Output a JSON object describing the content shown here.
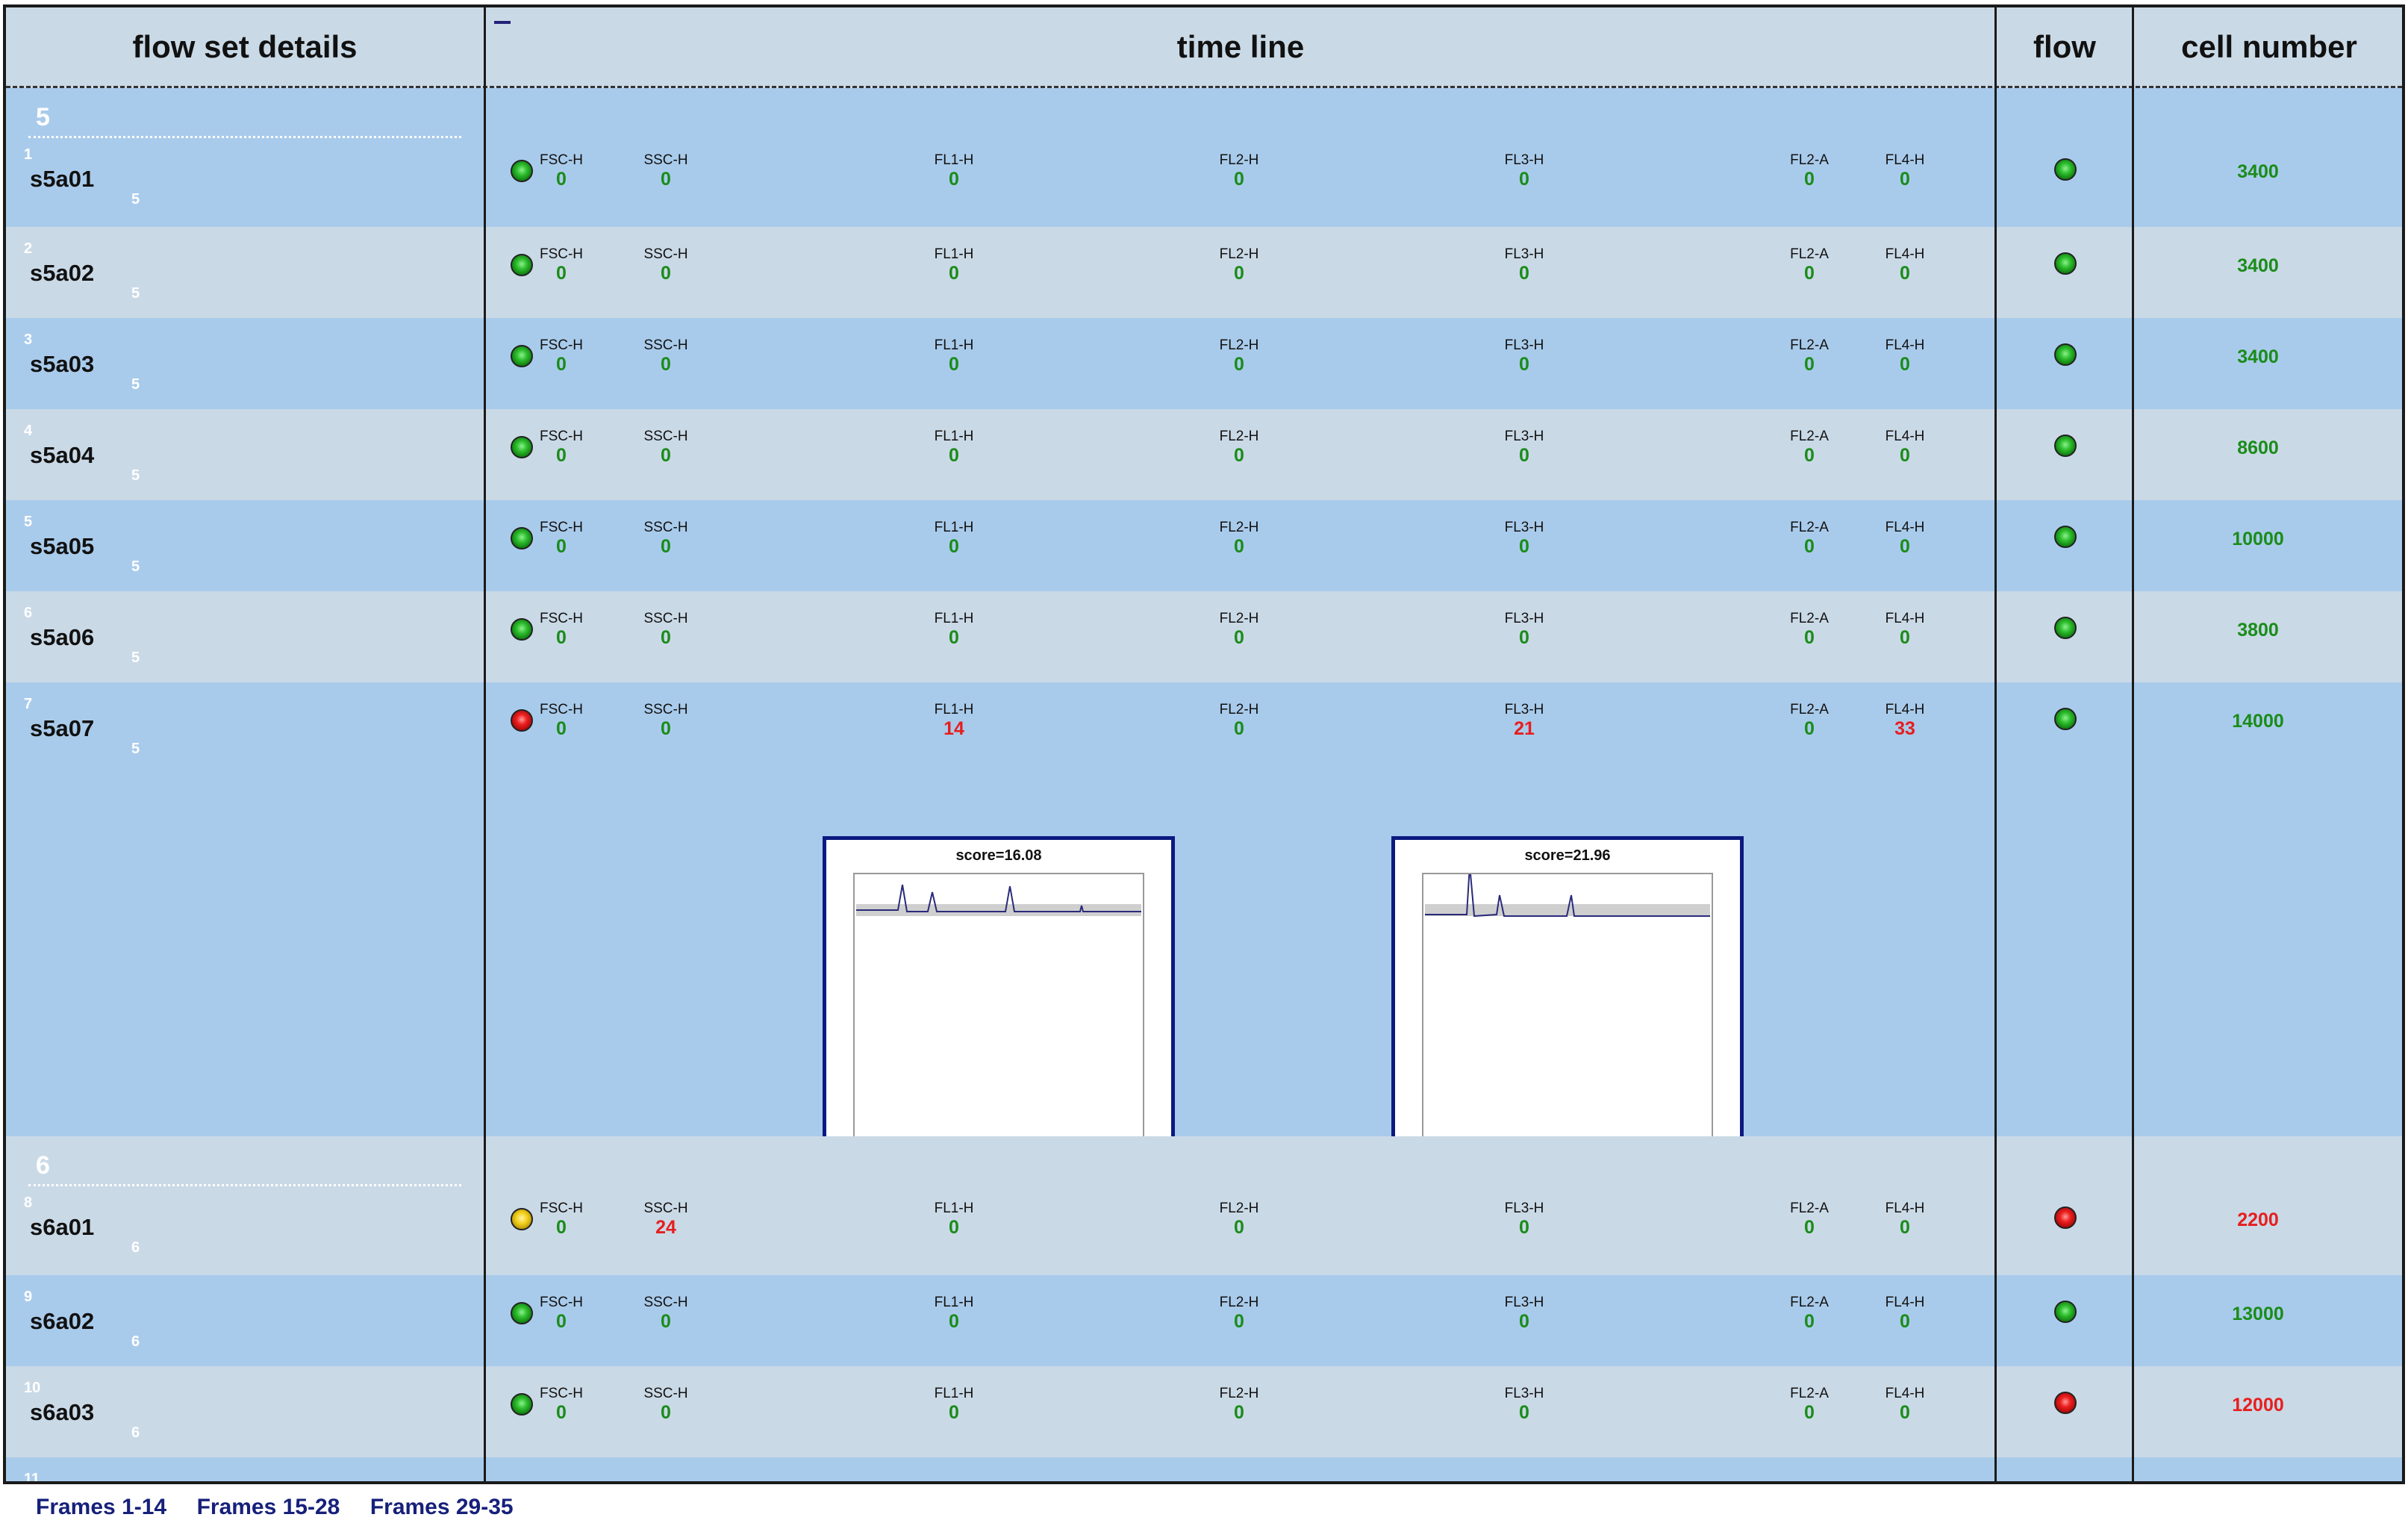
{
  "headers": {
    "details": "flow set details",
    "timeline": "time line",
    "flow": "flow",
    "cells": "cell number"
  },
  "channels": [
    "FSC-H",
    "SSC-H",
    "FL1-H",
    "FL2-H",
    "FL3-H",
    "FL2-A",
    "FL4-H"
  ],
  "groups": [
    {
      "label": "5",
      "rows": [
        {
          "index": "1",
          "name": "s5a01",
          "sub": "5",
          "status": "green",
          "values": [
            "0",
            "0",
            "0",
            "0",
            "0",
            "0",
            "0"
          ],
          "flow": "green",
          "cells": "3400"
        },
        {
          "index": "2",
          "name": "s5a02",
          "sub": "5",
          "status": "green",
          "values": [
            "0",
            "0",
            "0",
            "0",
            "0",
            "0",
            "0"
          ],
          "flow": "green",
          "cells": "3400"
        },
        {
          "index": "3",
          "name": "s5a03",
          "sub": "5",
          "status": "green",
          "values": [
            "0",
            "0",
            "0",
            "0",
            "0",
            "0",
            "0"
          ],
          "flow": "green",
          "cells": "3400"
        },
        {
          "index": "4",
          "name": "s5a04",
          "sub": "5",
          "status": "green",
          "values": [
            "0",
            "0",
            "0",
            "0",
            "0",
            "0",
            "0"
          ],
          "flow": "green",
          "cells": "8600"
        },
        {
          "index": "5",
          "name": "s5a05",
          "sub": "5",
          "status": "green",
          "values": [
            "0",
            "0",
            "0",
            "0",
            "0",
            "0",
            "0"
          ],
          "flow": "green",
          "cells": "10000"
        },
        {
          "index": "6",
          "name": "s5a06",
          "sub": "5",
          "status": "green",
          "values": [
            "0",
            "0",
            "0",
            "0",
            "0",
            "0",
            "0"
          ],
          "flow": "green",
          "cells": "3800"
        },
        {
          "index": "7",
          "name": "s5a07",
          "sub": "5",
          "status": "red",
          "values": [
            "0",
            "0",
            "14",
            "0",
            "21",
            "0",
            "33"
          ],
          "flow": "green",
          "cells": "14000",
          "plots": [
            {
              "channel": "FL1-H",
              "score": "score=16.08"
            },
            {
              "channel": "FL3-H",
              "score": "score=21.96"
            }
          ]
        }
      ]
    },
    {
      "label": "6",
      "rows": [
        {
          "index": "8",
          "name": "s6a01",
          "sub": "6",
          "status": "yellow",
          "values": [
            "0",
            "24",
            "0",
            "0",
            "0",
            "0",
            "0"
          ],
          "flow": "red",
          "cells": "2200"
        },
        {
          "index": "9",
          "name": "s6a02",
          "sub": "6",
          "status": "green",
          "values": [
            "0",
            "0",
            "0",
            "0",
            "0",
            "0",
            "0"
          ],
          "flow": "green",
          "cells": "13000"
        },
        {
          "index": "10",
          "name": "s6a03",
          "sub": "6",
          "status": "green",
          "values": [
            "0",
            "0",
            "0",
            "0",
            "0",
            "0",
            "0"
          ],
          "flow": "red",
          "cells": "12000"
        },
        {
          "index": "11"
        }
      ]
    }
  ],
  "footer": [
    "Frames 1-14",
    "Frames 15-28",
    "Frames 29-35"
  ]
}
